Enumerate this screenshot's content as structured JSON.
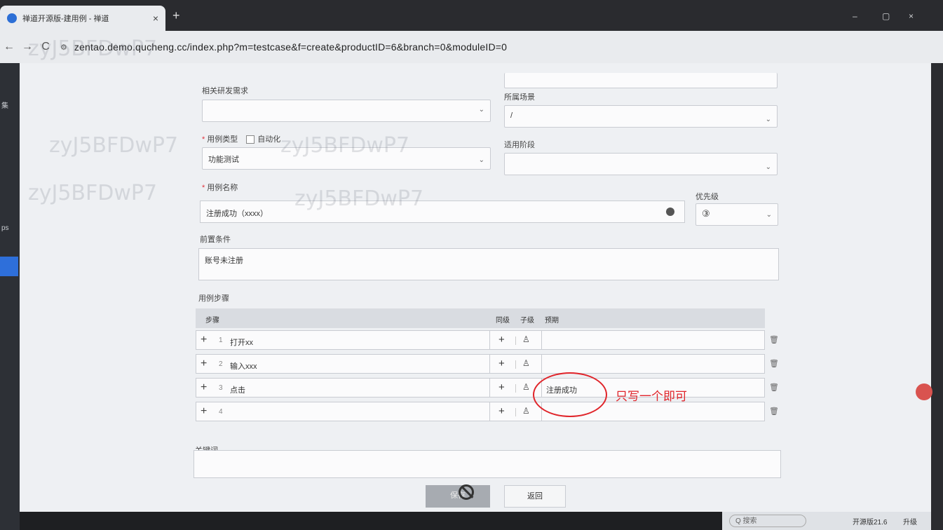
{
  "browser": {
    "tab_title": "禅道开源版-建用例 - 禅道",
    "tab_close": "×",
    "new_tab": "+",
    "url": "zentao.demo.qucheng.cc/index.php?m=testcase&f=create&productID=6&branch=0&moduleID=0",
    "back": "←",
    "forward": "→",
    "reload": "C",
    "site_info": "⚙",
    "zoom_icon": "🔍",
    "star_icon": "☆",
    "ext_icon": "▢",
    "profile_icon": "◎",
    "menu_icon": "⋮",
    "minimize": "–",
    "restore": "▢",
    "close": "×"
  },
  "sidebar": {
    "items": [
      "集",
      "ps"
    ]
  },
  "form": {
    "related_story_label": "相关研发需求",
    "scene_label": "所属场景",
    "scene_value": "/",
    "case_type_label": "用例类型",
    "automation_label": "自动化",
    "case_type_value": "功能测试",
    "stage_label": "适用阶段",
    "case_name_label": "用例名称",
    "case_name_value": "注册成功（xxxx）",
    "priority_label": "优先级",
    "priority_value": "③",
    "precondition_label": "前置条件",
    "precondition_value": "账号未注册",
    "steps_label": "用例步骤",
    "keywords_label": "关键词"
  },
  "steps": {
    "header_step": "步骤",
    "header_sibling": "同级",
    "header_child": "子级",
    "header_expect": "预期",
    "rows": [
      {
        "num": "1",
        "text": "打开xx",
        "expect": ""
      },
      {
        "num": "2",
        "text": "输入xxx",
        "expect": ""
      },
      {
        "num": "3",
        "text": "点击",
        "expect": "注册成功"
      },
      {
        "num": "4",
        "text": "",
        "expect": ""
      }
    ]
  },
  "annotation": {
    "text": "只写一个即可",
    "color": "#e0242a"
  },
  "buttons": {
    "save": "保存",
    "back": "返回"
  },
  "watermark": "zyJ5BFDwP7",
  "taskbar": {
    "search": "Q 搜索",
    "app_label": "开源版21.6",
    "upgrade": "升级"
  }
}
